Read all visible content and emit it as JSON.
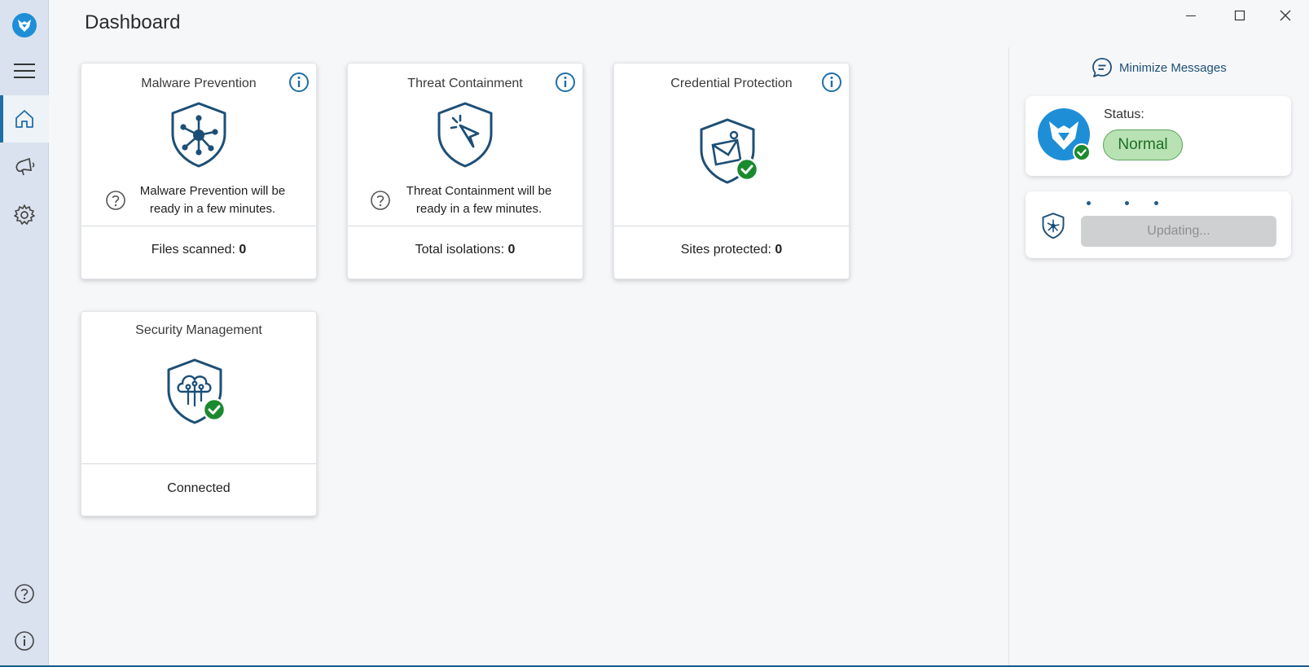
{
  "page": {
    "title": "Dashboard"
  },
  "nav": {
    "items": [
      {
        "icon": "hamburger-menu-icon"
      },
      {
        "icon": "home-icon",
        "active": true
      },
      {
        "icon": "megaphone-icon"
      },
      {
        "icon": "gear-icon"
      },
      {
        "icon": "help-icon"
      },
      {
        "icon": "info-icon"
      }
    ]
  },
  "cards": {
    "malware": {
      "title": "Malware Prevention",
      "message": "Malware Prevention will be ready in a few minutes.",
      "footer_label": "Files scanned:",
      "footer_value": "0"
    },
    "threat": {
      "title": "Threat Containment",
      "message": "Threat Containment will be ready in a few minutes.",
      "footer_label": "Total isolations:",
      "footer_value": "0"
    },
    "credential": {
      "title": "Credential Protection",
      "footer_label": "Sites protected:",
      "footer_value": "0"
    },
    "security": {
      "title": "Security Management",
      "footer_label": "Connected"
    }
  },
  "right_panel": {
    "minimize_label": "Minimize Messages",
    "status_label": "Status:",
    "status_value": "Normal",
    "updating_label": "Updating..."
  },
  "colors": {
    "accent": "#1f6fa6",
    "icon_navy": "#1d4f76",
    "ok_green": "#1a8a2e",
    "badge_bg": "#b9e2b4"
  }
}
